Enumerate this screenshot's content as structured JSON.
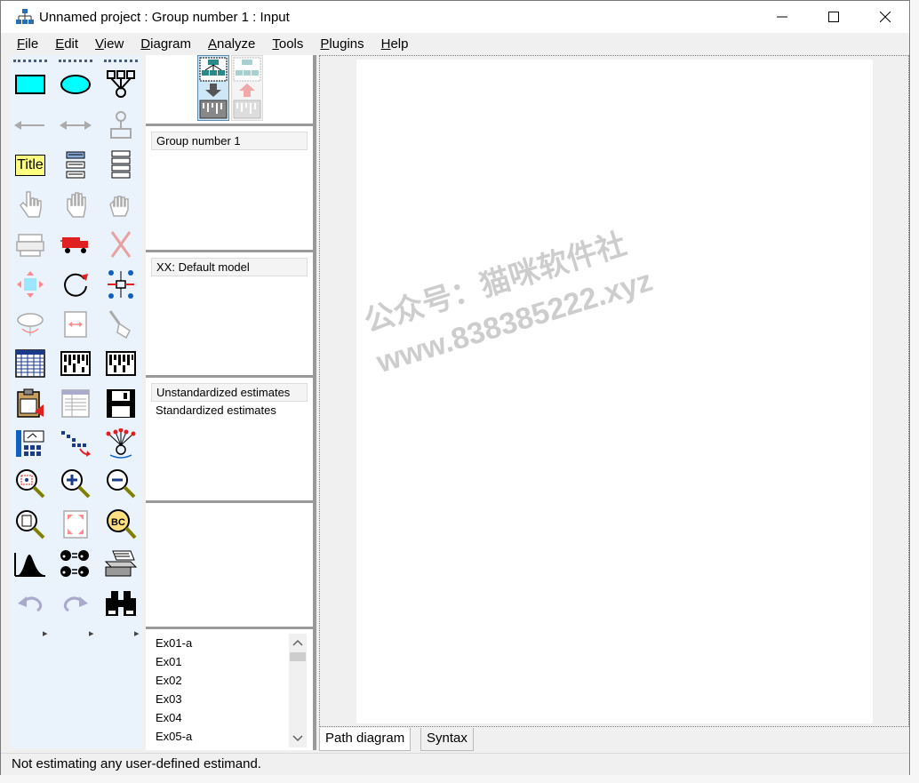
{
  "window": {
    "title": "Unnamed project : Group number 1 : Input"
  },
  "menu": [
    {
      "mnemonic": "F",
      "rest": "ile"
    },
    {
      "mnemonic": "E",
      "rest": "dit"
    },
    {
      "mnemonic": "V",
      "rest": "iew"
    },
    {
      "mnemonic": "D",
      "rest": "iagram"
    },
    {
      "mnemonic": "A",
      "rest": "nalyze"
    },
    {
      "mnemonic": "T",
      "rest": "ools"
    },
    {
      "mnemonic": "P",
      "rest": "lugins"
    },
    {
      "mnemonic": "H",
      "rest": "elp"
    }
  ],
  "toolbox": {
    "title_tool_label": "Title",
    "more_arrow": "▸"
  },
  "groups": {
    "items": [
      "Group number 1"
    ]
  },
  "models": {
    "items": [
      "XX: Default model"
    ]
  },
  "estimates": {
    "items": [
      "Unstandardized estimates",
      "Standardized estimates"
    ]
  },
  "files": {
    "items": [
      "Ex01-a",
      "Ex01",
      "Ex02",
      "Ex03",
      "Ex04",
      "Ex05-a"
    ]
  },
  "tabs": {
    "path_diagram": "Path diagram",
    "syntax": "Syntax"
  },
  "status": {
    "text": "Not estimating any user-defined estimand."
  },
  "watermark": {
    "line1": "公众号：猫咪软件社",
    "line2": "www.838385222.xyz"
  },
  "colors": {
    "toolbox_bg": "#eaf2fb",
    "rect_tool": "#00ffff",
    "title_tool": "#ffff80",
    "accent_red": "#e02020",
    "accent_blue": "#1060c0"
  }
}
